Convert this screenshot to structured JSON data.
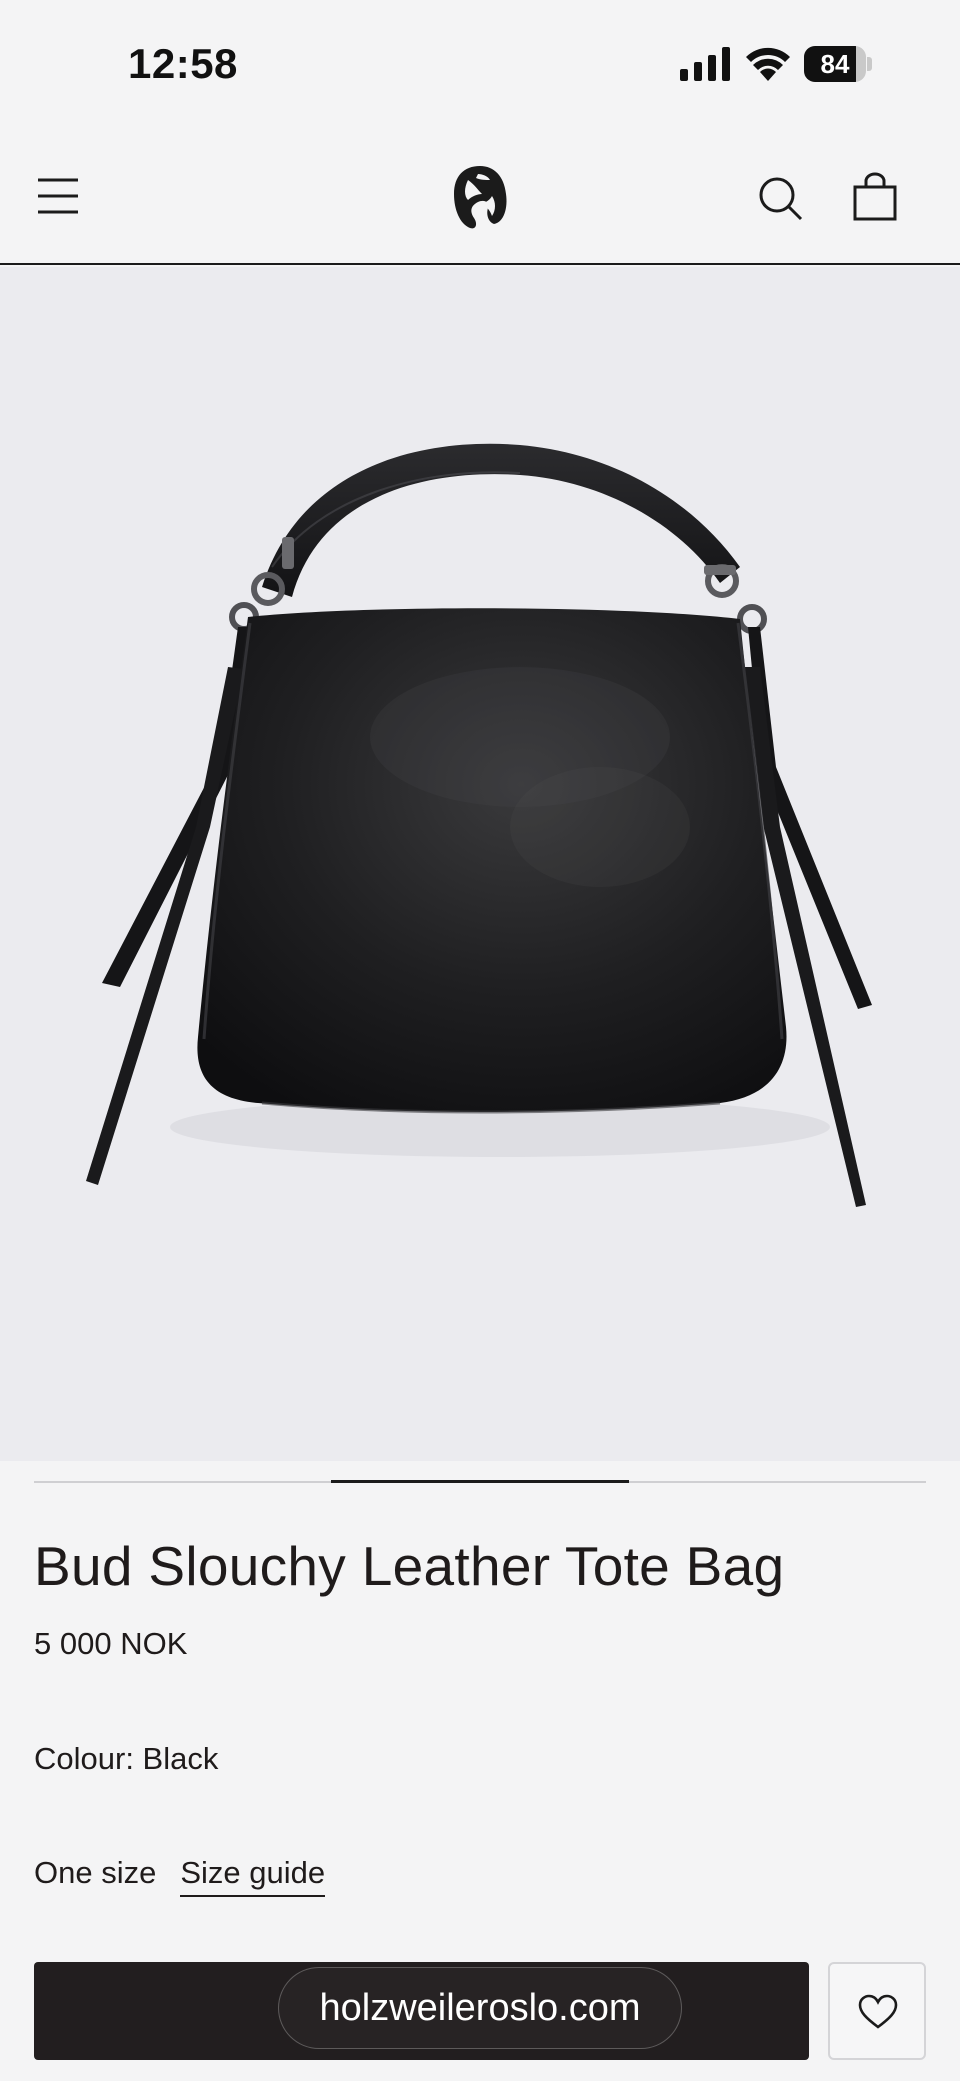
{
  "status_bar": {
    "time": "12:58",
    "battery_percent": "84",
    "battery_level": 0.84,
    "icons": [
      "signal-icon",
      "wifi-icon",
      "battery-icon"
    ]
  },
  "header": {
    "menu_icon": "hamburger-menu-icon",
    "logo_icon": "holzweiler-logo",
    "search_icon": "search-icon",
    "bag_icon": "shopping-bag-icon"
  },
  "product": {
    "image_alt": "black-leather-tote-bag",
    "title": "Bud Slouchy Leather Tote Bag",
    "price": "5 000 NOK",
    "colour": "Colour: Black",
    "size": "One size",
    "size_guide": "Size guide"
  },
  "carousel": {
    "active_index": 1,
    "total": 3
  },
  "actions": {
    "wishlist_icon": "heart-icon"
  },
  "browser": {
    "url": "holzweileroslo.com"
  },
  "colors": {
    "background": "#f4f4f5",
    "image_background": "#ebebef",
    "text": "#1f1b1b",
    "button": "#221e1f"
  }
}
